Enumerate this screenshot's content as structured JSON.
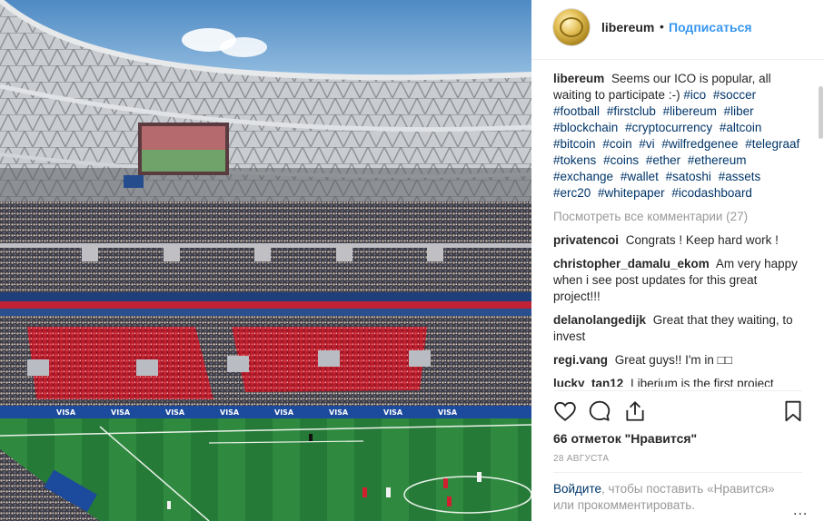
{
  "header": {
    "username": "libereum",
    "separator": "•",
    "follow_label": "Подписаться"
  },
  "caption": {
    "username": "libereum",
    "text": "Seems our ICO is popular, all waiting to participate :-)",
    "hashtags": [
      "#ico",
      "#soccer",
      "#football",
      "#firstclub",
      "#libereum",
      "#liber",
      "#blockchain",
      "#cryptocurrency",
      "#altcoin",
      "#bitcoin",
      "#coin",
      "#vi",
      "#wilfredgenee",
      "#telegraaf",
      "#tokens",
      "#coins",
      "#ether",
      "#ethereum",
      "#exchange",
      "#wallet",
      "#satoshi",
      "#assets",
      "#erc20",
      "#whitepaper",
      "#icodashboard"
    ]
  },
  "view_all_comments": "Посмотреть все комментарии (27)",
  "comments": [
    {
      "user": "privatencoi",
      "text": "Congrats ! Keep hard work !"
    },
    {
      "user": "christopher_damalu_ekom",
      "text": "Am very happy when i see post updates for this great project!!!"
    },
    {
      "user": "delanolangedijk",
      "text": "Great that they waiting, to invest"
    },
    {
      "user": "regi.vang",
      "text": "Great guys!! I'm in □□"
    },
    {
      "user": "lucky_tan12",
      "text": "Liberium is the first project"
    }
  ],
  "actions": {
    "like_icon": "heart-icon",
    "comment_icon": "speech-bubble-icon",
    "share_icon": "share-icon",
    "save_icon": "bookmark-icon"
  },
  "likes": {
    "count": "66 отметок",
    "label": "\"Нравится\""
  },
  "date": "28 АВГУСТА",
  "login_prompt": {
    "link": "Войдите",
    "text": ", чтобы поставить «Нравится» или прокомментировать."
  },
  "more_label": "..."
}
